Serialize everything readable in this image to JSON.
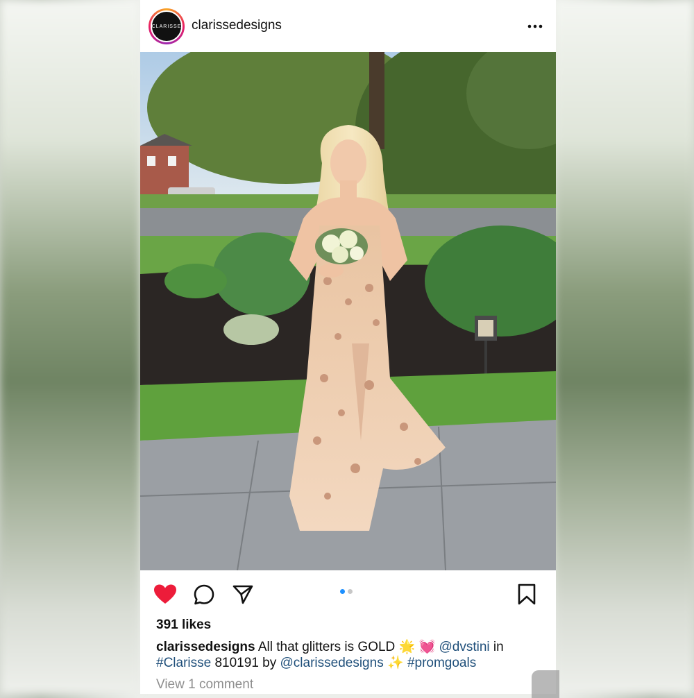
{
  "post": {
    "username": "clarissedesigns",
    "avatar_text": "CLARISSE",
    "likes": "391 likes",
    "caption": {
      "user": "clarissedesigns",
      "text1": "All that glitters is GOLD",
      "emoji1": "🌟",
      "emoji2": "💓",
      "mention1": "@dvstini",
      "in_word": "in",
      "hashtag1": "#Clarisse",
      "text2": "810191 by",
      "mention2": "@clarissedesigns",
      "emoji3": "✨",
      "hashtag2": "#promgoals"
    },
    "view_comments": "View 1 comment"
  },
  "icons": {
    "more": "more-horizontal-icon",
    "like": "heart-filled-icon",
    "comment": "comment-bubble-icon",
    "share": "send-paper-plane-icon",
    "save": "bookmark-icon"
  },
  "carousel": {
    "count": 2,
    "active_index": 0,
    "active_color": "#1e90ff",
    "inactive_color": "#c7c7c7"
  },
  "colors": {
    "like_red": "#ed1c3a",
    "hashtag_blue": "#1f4f7a",
    "muted_gray": "#8e8e8e"
  }
}
